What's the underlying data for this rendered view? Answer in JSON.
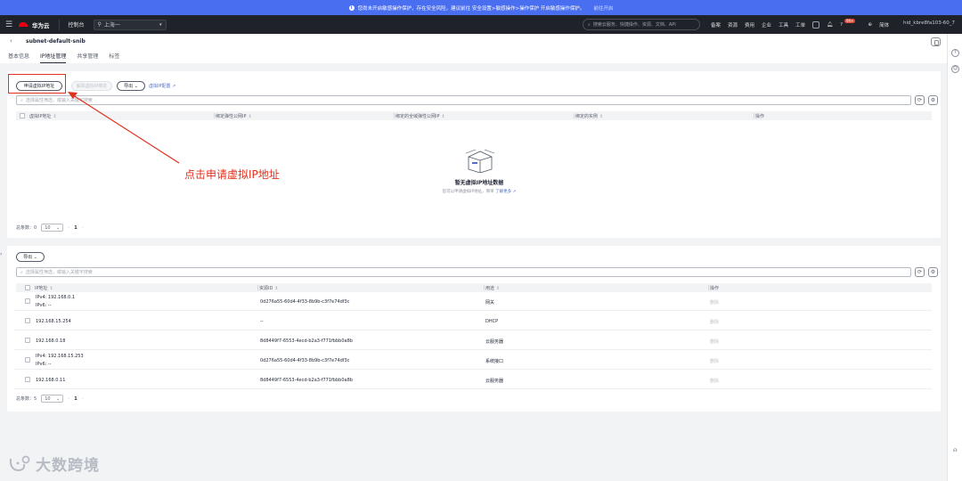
{
  "notice": {
    "text": "您尚未开启敏感操作保护，存在安全风险，建议前往 安全设置>敏感操作>操作保护 开启敏感操作保护。",
    "link": "前往开启"
  },
  "topnav": {
    "brand": "华为云",
    "console": "控制台",
    "region": "上海一",
    "search_placeholder": "搜索云服务、快捷操作、资源、文档、API",
    "links": [
      "备案",
      "资源",
      "费用",
      "企业",
      "工具",
      "工单"
    ],
    "badge": "99+",
    "lang": "简体",
    "account": "hid_kbre8fa103-60_7"
  },
  "header": {
    "title": "subnet-default-snib",
    "tabs": [
      "基本信息",
      "IP地址管理",
      "共享管理",
      "标签"
    ],
    "active_tab": 1
  },
  "card1": {
    "apply_btn": "申请虚拟IP地址",
    "unbind_btn": "解除虚拟IP绑定",
    "export_btn": "导出",
    "learn_link": "虚拟IP配置",
    "filter_placeholder": "选择属性筛选，或输入关键字搜索",
    "columns": [
      "虚拟IP地址",
      "绑定弹性公网IP",
      "绑定的全域弹性公网IP",
      "绑定的实例",
      "操作"
    ],
    "empty_title": "暂无虚拟IP地址数据",
    "empty_desc": "您可以申请虚拟IP地址，简单",
    "empty_link": "了解更多",
    "total": "总条数：0",
    "page_size": "10",
    "page": "1"
  },
  "card2": {
    "export_btn": "导出",
    "filter_placeholder": "选择属性筛选，或输入关键字搜索",
    "columns": [
      "IP地址",
      "资源ID",
      "用途",
      "操作"
    ],
    "rows": [
      {
        "ip": "IPv4: 192.168.0.1",
        "ip6": "IPv6: --",
        "rid": "0d276a55-60d4-4f33-8b9b-c3f7e74df3c",
        "use": "网关",
        "op": "删除"
      },
      {
        "ip": "192.168.15.254",
        "ip6": "",
        "rid": "--",
        "use": "DHCP",
        "op": "删除"
      },
      {
        "ip": "192.168.0.18",
        "ip6": "",
        "rid": "8d8449f7-6553-4ecd-b2a3-f771fbbb0a8b",
        "use": "云服务器",
        "op": "删除"
      },
      {
        "ip": "IPv4: 192.168.15.253",
        "ip6": "IPv6: --",
        "rid": "0d276a55-60d4-4f33-8b9b-c3f7e74df3c",
        "use": "系统接口",
        "op": "删除"
      },
      {
        "ip": "192.168.0.11",
        "ip6": "",
        "rid": "8d8449f7-6553-4ecd-b2a3-f771fbbb0a8b",
        "use": "云服务器",
        "op": "删除"
      }
    ],
    "total": "总条数：5",
    "page_size": "10",
    "page": "1"
  },
  "annotation": {
    "text": "点击申请虚拟IP地址",
    "color": "#e0301e"
  },
  "watermark": "大数跨境"
}
